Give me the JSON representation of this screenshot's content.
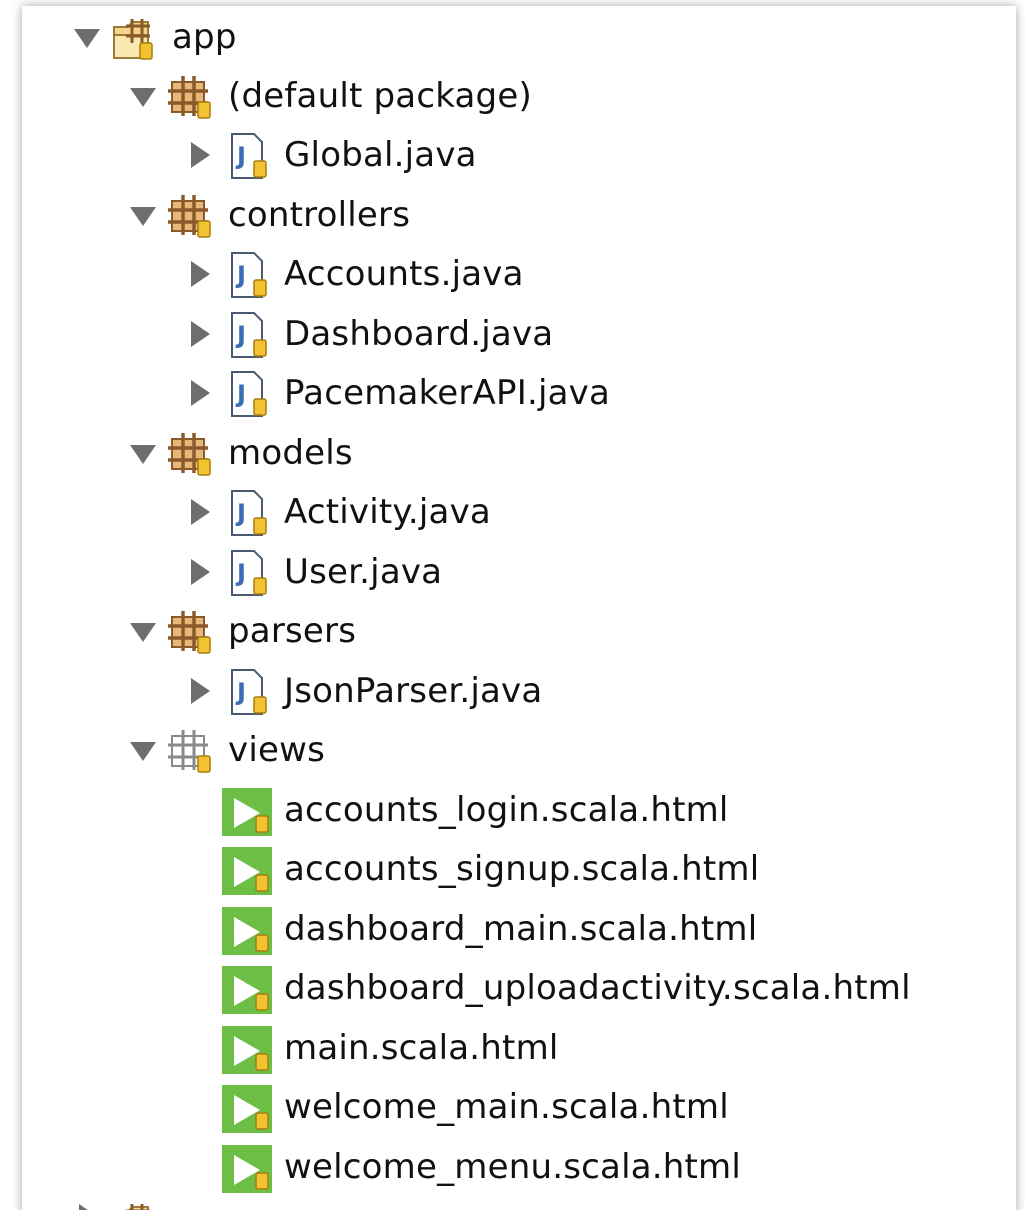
{
  "tree": {
    "root": {
      "label": "app",
      "expanded": true,
      "icon": "source-folder-icon"
    },
    "packages": [
      {
        "label": "(default package)",
        "expanded": true,
        "icon": "package-icon",
        "files": [
          {
            "label": "Global.java",
            "icon": "java-file-icon",
            "expandable": true
          }
        ]
      },
      {
        "label": "controllers",
        "expanded": true,
        "icon": "package-icon",
        "files": [
          {
            "label": "Accounts.java",
            "icon": "java-file-icon",
            "expandable": true
          },
          {
            "label": "Dashboard.java",
            "icon": "java-file-icon",
            "expandable": true
          },
          {
            "label": "PacemakerAPI.java",
            "icon": "java-file-icon",
            "expandable": true
          }
        ]
      },
      {
        "label": "models",
        "expanded": true,
        "icon": "package-icon",
        "files": [
          {
            "label": "Activity.java",
            "icon": "java-file-icon",
            "expandable": true
          },
          {
            "label": "User.java",
            "icon": "java-file-icon",
            "expandable": true
          }
        ]
      },
      {
        "label": "parsers",
        "expanded": true,
        "icon": "package-icon",
        "files": [
          {
            "label": "JsonParser.java",
            "icon": "java-file-icon",
            "expandable": true
          }
        ]
      },
      {
        "label": "views",
        "expanded": true,
        "icon": "non-java-package-icon",
        "files": [
          {
            "label": "accounts_login.scala.html",
            "icon": "scala-template-icon",
            "expandable": false
          },
          {
            "label": "accounts_signup.scala.html",
            "icon": "scala-template-icon",
            "expandable": false
          },
          {
            "label": "dashboard_main.scala.html",
            "icon": "scala-template-icon",
            "expandable": false
          },
          {
            "label": "dashboard_uploadactivity.scala.html",
            "icon": "scala-template-icon",
            "expandable": false
          },
          {
            "label": "main.scala.html",
            "icon": "scala-template-icon",
            "expandable": false
          },
          {
            "label": "welcome_main.scala.html",
            "icon": "scala-template-icon",
            "expandable": false
          },
          {
            "label": "welcome_menu.scala.html",
            "icon": "scala-template-icon",
            "expandable": false
          }
        ]
      }
    ],
    "next_sibling": {
      "label": "",
      "expanded": false,
      "icon": "source-folder-icon"
    }
  },
  "colors": {
    "twisty": "#6e6e6e",
    "package_brown": "#8a5a2a",
    "package_fill": "#d7a86a",
    "java_blue": "#3a6db5",
    "scala_green": "#6cbe45",
    "lock_yellow": "#f2c230",
    "text": "#111111"
  }
}
